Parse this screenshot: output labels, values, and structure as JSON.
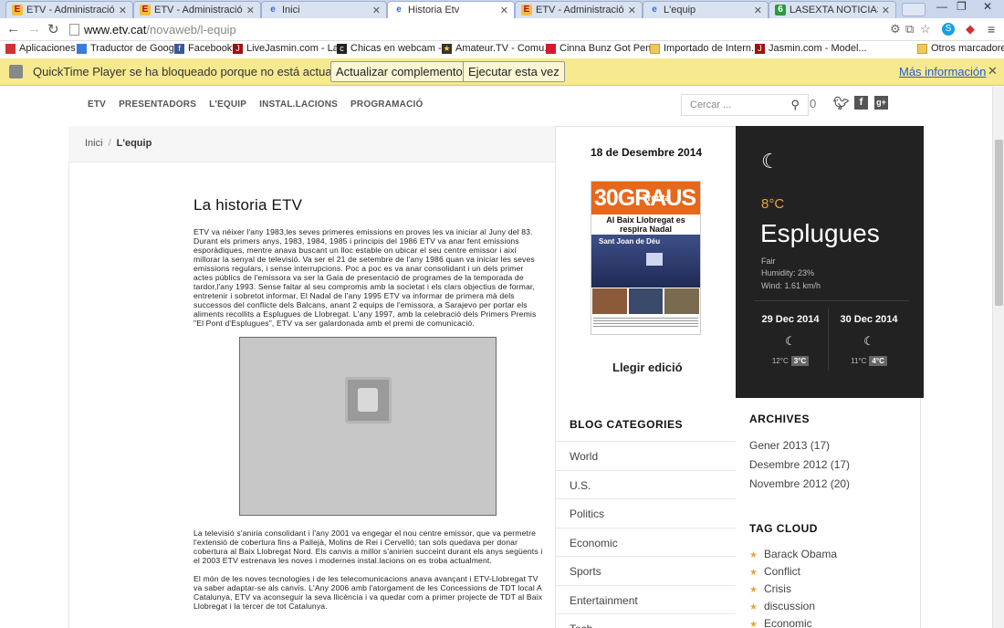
{
  "browser": {
    "tabs": [
      {
        "title": "ETV - Administració - Ge",
        "icon": "etv"
      },
      {
        "title": "ETV - Administració - Ge",
        "icon": "etv"
      },
      {
        "title": "Inici",
        "icon": "ie"
      },
      {
        "title": "Historia Etv",
        "icon": "ie"
      },
      {
        "title": "ETV - Administració - Ge",
        "icon": "etv"
      },
      {
        "title": "L'equip",
        "icon": "ie"
      },
      {
        "title": "LASEXTA NOTICIAS. Últi",
        "icon": "sexta"
      }
    ],
    "url_host": "www.etv.cat",
    "url_path": "/novaweb/l-equip",
    "bookmarks": [
      "Aplicaciones",
      "Traductor de Google",
      "Facebook",
      "LiveJasmin.com - La...",
      "Chicas en webcam -...",
      "Amateur.TV - Comu...",
      "Cinna Bunz Got Pen...",
      "Importado de Intern...",
      "Jasmin.com - Model...",
      "Otros marcadores"
    ],
    "infobar": {
      "message": "QuickTime Player se ha bloqueado porque no está actualizado.",
      "update_label": "Actualizar complemento...",
      "run_label": "Ejecutar esta vez",
      "more_label": "Más información"
    }
  },
  "site": {
    "nav": [
      "ETV",
      "PRESENTADORS",
      "L'EQUIP",
      "INSTAL.LACIONS",
      "PROGRAMACIÓ"
    ],
    "search_placeholder": "Cercar ...",
    "cart_count": "0",
    "breadcrumb": {
      "home": "Inici",
      "current": "L'equip"
    },
    "article": {
      "title": "La historia ETV",
      "p1": "ETV va néixer l'any 1983,les seves primeres emissions en proves les va iniciar al Juny del 83. Durant els primers anys, 1983, 1984, 1985 i principis del 1986 ETV va anar fent emissions esporàdiques, mentre anava buscant un lloc estable on ubicar el seu centre emissor i així millorar la senyal de televisió. Va ser el 21 de setembre de l'any 1986 quan va iniciar les seves emissions regulars, i sense interrupcions. Poc a poc es va anar consolidant i un dels primer actes públics de l'emissora va ser la Gala de presentació de programes de la temporada de tardor,l'any 1993. Sense faltar al seu compromis amb la societat i els clars objectius de formar, entretenir i sobretot informar, El Nadal de l'any 1995 ETV va informar de primera mà dels successos del conflicte dels Balcans, anant 2 equips de l'emissora, a Sarajevo per portar els aliments recollits a Esplugues de Llobregat. L'any 1997, amb la celebració dels Primers Premis \"El Pont d'Esplugues\", ETV va ser galardonada amb el premi de comunicació.",
      "p2": "La televisió s'aniria consolidant i l'any 2001 va engegar el nou centre emissor, que va permetre l'extensió de cobertura fins a Pallejà, Molins de Rei i Cervelló; tan sols quedava per donar cobertura al Baix Llobregat Nord. Els canvis a millor s'anirien succeint durant els anys següents i el 2003 ETV estrenava les noves i modernes instal.lacions on es troba actualment.",
      "p3": "El món de les noves tecnologies i de les telecomunicacions anava avançant i ETV-Llobregat TV va saber adaptar-se als canvis. L'Any 2006 amb l'atorgament de les Concessions de TDT local A Catalunya, ETV va aconseguir la seva llicència i va quedar com a primer projecte de TDT al Baix Llobregat i la tercer de tot Catalunya."
    },
    "edition": {
      "date": "18 de Desembre 2014",
      "paper_name": "30GRAUS",
      "paper_top": "Trenta",
      "paper_headline": "Al Baix Llobregat es respira Nadal",
      "paper_photo_caption": "Sant Joan de Déu",
      "read_label": "Llegir edició"
    },
    "weather": {
      "temp": "8°C",
      "city": "Esplugues",
      "condition": "Fair",
      "humidity": "Humidity: 23%",
      "wind": "Wind: 1.61 km/h",
      "forecast": [
        {
          "date": "29 Dec 2014",
          "low": "12°C",
          "high": "3°C"
        },
        {
          "date": "30 Dec 2014",
          "low": "11°C",
          "high": "4°C"
        }
      ]
    },
    "blog_categories": {
      "title": "BLOG CATEGORIES",
      "items": [
        "World",
        "U.S.",
        "Politics",
        "Economic",
        "Sports",
        "Entertainment",
        "Tech"
      ]
    },
    "archives": {
      "title": "ARCHIVES",
      "items": [
        "Gener 2013 (17)",
        "Desembre 2012 (17)",
        "Novembre 2012 (20)"
      ]
    },
    "tag_cloud": {
      "title": "TAG CLOUD",
      "items": [
        "Barack Obama",
        "Conflict",
        "Crisis",
        "discussion",
        "Economic"
      ]
    }
  }
}
